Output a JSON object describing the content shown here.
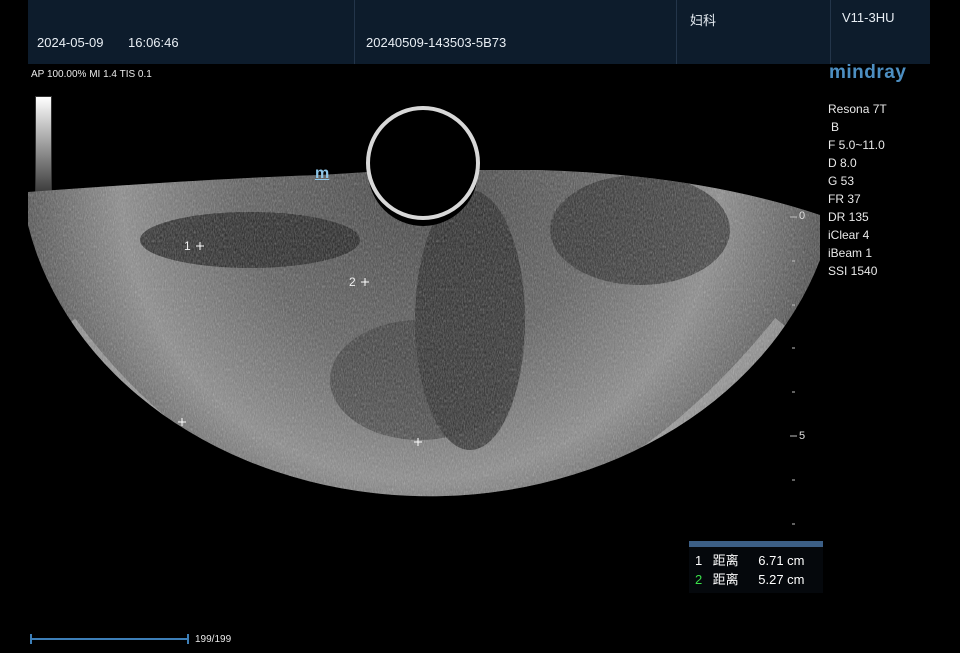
{
  "header": {
    "date": "2024-05-09",
    "time": "16:06:46",
    "patient_id": "20240509-143503-5B73",
    "department": "妇科",
    "probe": "V11-3HU"
  },
  "brand": "mindray",
  "acoustic_output": "AP 100.00%  MI 1.4 TIS 0.1",
  "imaging_params": {
    "system": "Resona 7T",
    "mode": "B",
    "frequency": "F 5.0~11.0",
    "depth": "D 8.0",
    "gain": "G 53",
    "frame_rate": "FR 37",
    "dynamic_range": "DR 135",
    "iclear": "iClear 4",
    "ibeam": "iBeam 1",
    "ssi": "SSI 1540"
  },
  "depth_scale": {
    "top_label": "0",
    "mid_label": "5"
  },
  "markers": {
    "m1": "1",
    "m2": "2",
    "probe_mark": "m"
  },
  "measurements": [
    {
      "index": "1",
      "label": "距离",
      "value": "6.71 cm",
      "color": "#ffffff"
    },
    {
      "index": "2",
      "label": "距离",
      "value": "5.27 cm",
      "color": "#39e04a"
    }
  ],
  "cine": {
    "frames": "199/199",
    "progress": 1.0
  }
}
